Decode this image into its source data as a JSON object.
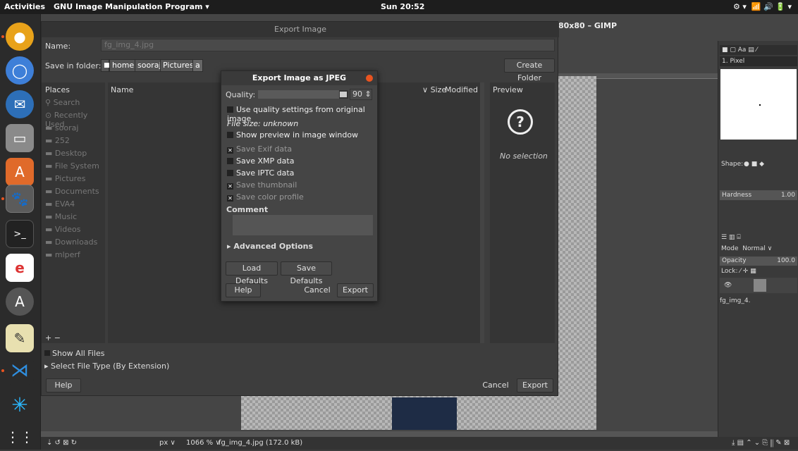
{
  "topbar": {
    "activities": "Activities",
    "app_menu": "GNU Image Manipulation Program ▾",
    "clock": "Sun 20:52",
    "gimp_window_title": "80x80 – GIMP"
  },
  "export_dialog": {
    "title": "Export Image",
    "name_label": "Name:",
    "name_value": "fg_img_4.jpg",
    "save_in_label": "Save in folder:",
    "path": [
      "home",
      "sooraj",
      "Pictures",
      "a"
    ],
    "create_folder": "Create Folder",
    "places_header": "Places",
    "name_header": "Name",
    "size_header": "Size",
    "modified_header": "Modified",
    "preview_header": "Preview",
    "no_selection": "No selection",
    "places": [
      "Search",
      "Recently Used",
      "sooraj",
      "252",
      "Desktop",
      "File System",
      "Pictures",
      "Documents",
      "EVA4",
      "Music",
      "Videos",
      "Downloads",
      "mlperf"
    ],
    "add_remove": "+ −",
    "show_all_files": "Show All Files",
    "select_file_type": "Select File Type (By Extension)",
    "help": "Help",
    "cancel": "Cancel",
    "export": "Export"
  },
  "jpeg_dialog": {
    "title": "Export Image as JPEG",
    "quality_label": "Quality:",
    "quality_value": "90",
    "quality_fraction": 0.9,
    "use_quality": "Use quality settings from original image",
    "file_size": "File size: unknown",
    "show_preview": "Show preview in image window",
    "save_exif": "Save Exif data",
    "save_xmp": "Save XMP data",
    "save_iptc": "Save IPTC data",
    "save_thumbnail": "Save thumbnail",
    "save_color_profile": "Save color profile",
    "comment_label": "Comment",
    "advanced": "Advanced Options",
    "load_defaults": "Load Defaults",
    "save_defaults": "Save Defaults",
    "help": "Help",
    "cancel": "Cancel",
    "export": "Export"
  },
  "right_dock": {
    "brush_name": "1. Pixel",
    "shape_label": "Shape:",
    "hardness_label": "Hardness",
    "hardness_value": "1.00",
    "mode_label": "Mode",
    "mode_value": "Normal ∨",
    "opacity_label": "Opacity",
    "opacity_value": "100.0",
    "lock_label": "Lock:",
    "layer_name": "fg_img_4."
  },
  "statusbar": {
    "unit": "px",
    "zoom": "1066 %",
    "file_info": "fg_img_4.jpg (172.0 kB)"
  }
}
